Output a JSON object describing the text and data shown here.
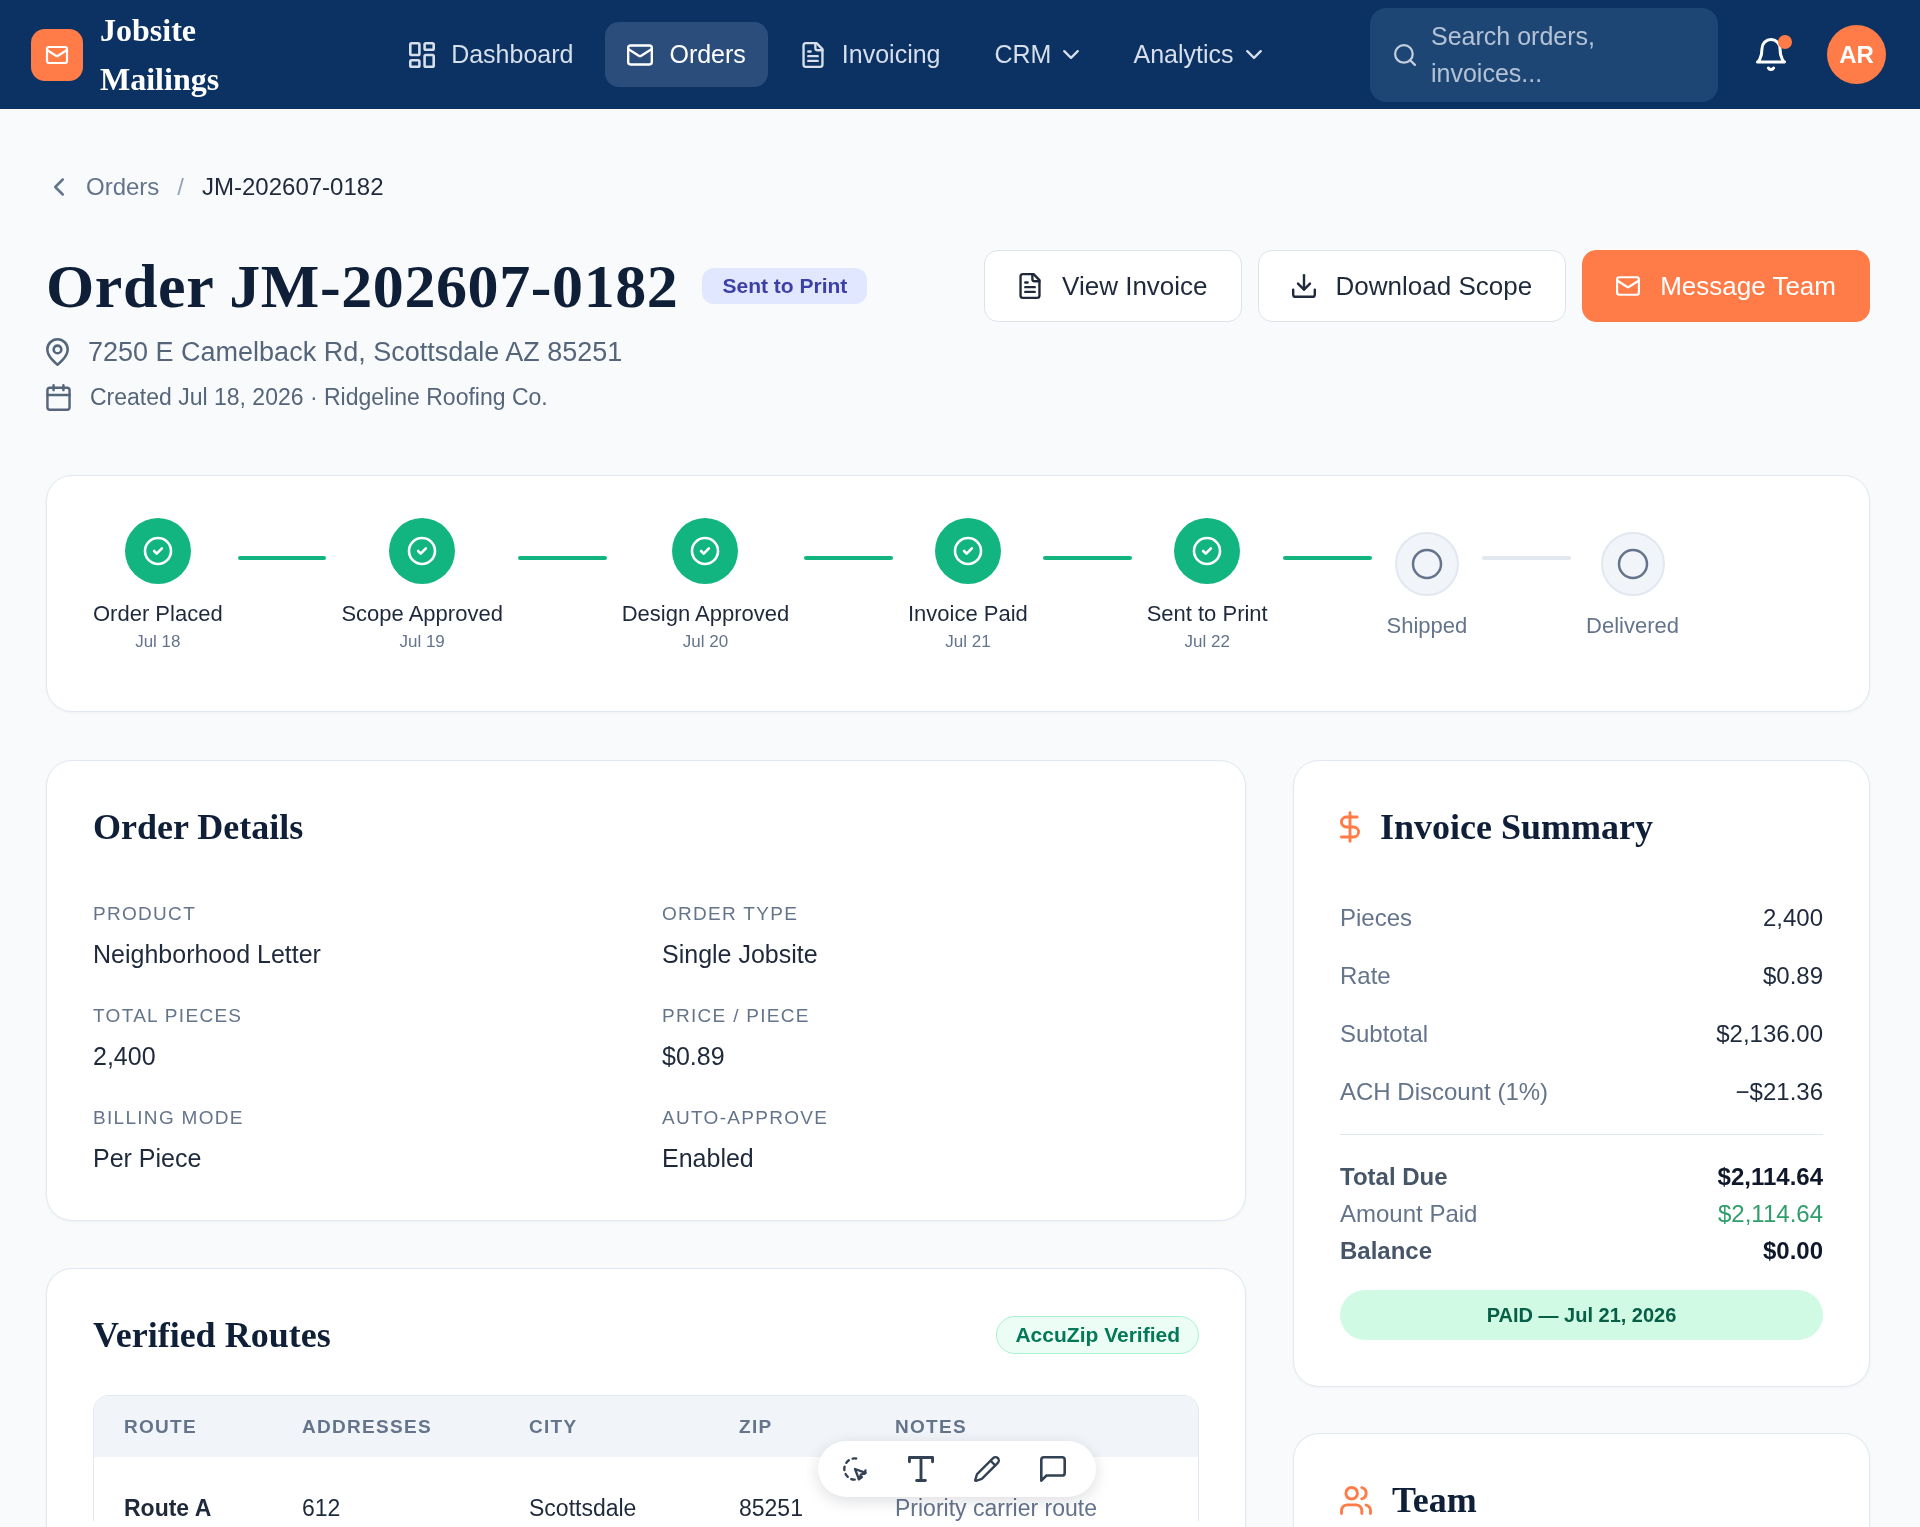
{
  "brand": {
    "name": "Jobsite Mailings"
  },
  "nav": {
    "items": [
      {
        "label": "Dashboard",
        "selected": false,
        "dropdown": false
      },
      {
        "label": "Orders",
        "selected": true,
        "dropdown": false
      },
      {
        "label": "Invoicing",
        "selected": false,
        "dropdown": false
      },
      {
        "label": "CRM",
        "selected": false,
        "dropdown": true
      },
      {
        "label": "Analytics",
        "selected": false,
        "dropdown": true
      }
    ]
  },
  "search": {
    "placeholder": "Search orders, invoices..."
  },
  "notifications": {
    "unread": true
  },
  "user": {
    "initials": "AR"
  },
  "breadcrumb": {
    "items": [
      {
        "label": "Orders",
        "current": false
      },
      {
        "label": "JM-202607-0182",
        "current": true
      }
    ],
    "separator": "/"
  },
  "order": {
    "title": "Order JM-202607-0182",
    "status": "Sent to Print",
    "address": "7250 E Camelback Rd, Scottsdale AZ 85251",
    "created": "Created Jul 18, 2026 · Ridgeline Roofing Co.",
    "actions": [
      {
        "label": "View Invoice",
        "kind": "secondary"
      },
      {
        "label": "Download Scope",
        "kind": "secondary"
      },
      {
        "label": "Message Team",
        "kind": "primary"
      }
    ]
  },
  "progress": {
    "steps": [
      {
        "label": "Order Placed",
        "date": "Jul 18",
        "done": true
      },
      {
        "label": "Scope Approved",
        "date": "Jul 19",
        "done": true
      },
      {
        "label": "Design Approved",
        "date": "Jul 20",
        "done": true
      },
      {
        "label": "Invoice Paid",
        "date": "Jul 21",
        "done": true
      },
      {
        "label": "Sent to Print",
        "date": "Jul 22",
        "done": true
      },
      {
        "label": "Shipped",
        "done": false
      },
      {
        "label": "Delivered",
        "done": false
      }
    ]
  },
  "order_details": {
    "title": "Order Details",
    "fields": [
      {
        "label": "PRODUCT",
        "value": "Neighborhood Letter"
      },
      {
        "label": "ORDER TYPE",
        "value": "Single Jobsite"
      },
      {
        "label": "TOTAL PIECES",
        "value": "2,400"
      },
      {
        "label": "PRICE / PIECE",
        "value": "$0.89"
      },
      {
        "label": "BILLING MODE",
        "value": "Per Piece"
      },
      {
        "label": "AUTO-APPROVE",
        "value": "Enabled"
      }
    ]
  },
  "invoice_summary": {
    "title": "Invoice Summary",
    "lines": [
      {
        "label": "Pieces",
        "value": "2,400"
      },
      {
        "label": "Rate",
        "value": "$0.89"
      },
      {
        "label": "Subtotal",
        "value": "$2,136.00"
      },
      {
        "label": "ACH Discount (1%)",
        "value": "−$21.36"
      }
    ],
    "totals": [
      {
        "label": "Total Due",
        "value": "$2,114.64",
        "kind": "total"
      },
      {
        "label": "Amount Paid",
        "value": "$2,114.64",
        "kind": "paid"
      },
      {
        "label": "Balance",
        "value": "$0.00",
        "kind": "total"
      }
    ],
    "status": "PAID — Jul 21, 2026"
  },
  "verified_routes": {
    "title": "Verified Routes",
    "badge": "AccuZip Verified",
    "table": {
      "columns": [
        "ROUTE",
        "ADDRESSES",
        "CITY",
        "ZIP",
        "NOTES"
      ],
      "rows": [
        [
          "Route A",
          "612",
          "Scottsdale",
          "85251",
          "Priority carrier route"
        ]
      ]
    }
  },
  "team": {
    "title": "Team"
  },
  "annotation_toolbar": {
    "tools": [
      {
        "kind": "select"
      },
      {
        "kind": "text"
      },
      {
        "kind": "draw"
      },
      {
        "kind": "comment"
      }
    ]
  }
}
